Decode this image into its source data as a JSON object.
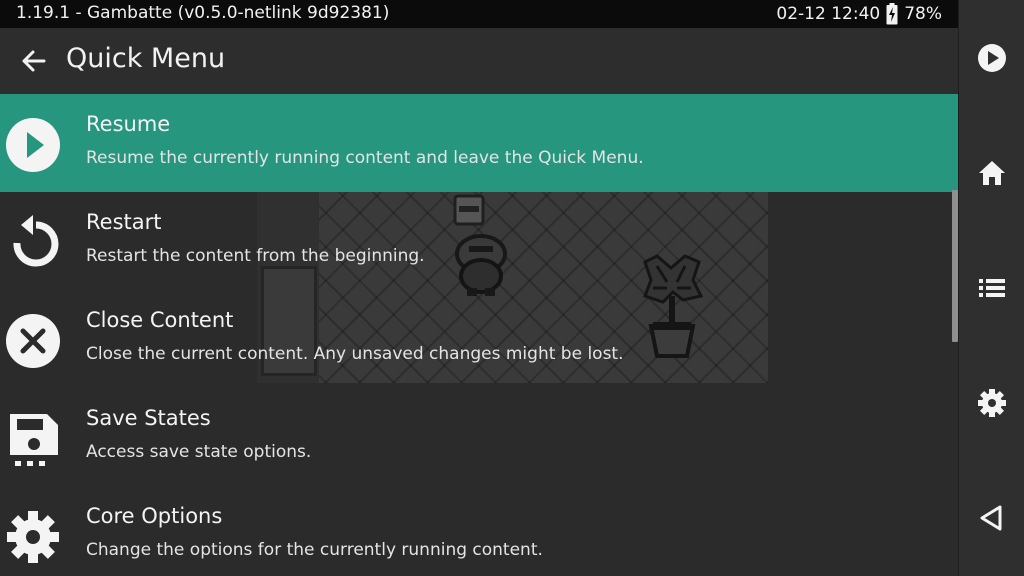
{
  "status_bar": {
    "title": "1.19.1 - Gambatte (v0.5.0-netlink 9d92381)",
    "datetime": "02-12 12:40",
    "battery_icon": "battery-charging-icon",
    "battery": "78%"
  },
  "header": {
    "back_icon": "arrow-left-icon",
    "title": "Quick Menu"
  },
  "menu": {
    "items": [
      {
        "icon": "play-circle-icon",
        "label": "Resume",
        "description": "Resume the currently running content and leave the Quick Menu.",
        "selected": true
      },
      {
        "icon": "restart-icon",
        "label": "Restart",
        "description": "Restart the content from the beginning.",
        "selected": false
      },
      {
        "icon": "close-circle-icon",
        "label": "Close Content",
        "description": "Close the current content. Any unsaved changes might be lost.",
        "selected": false
      },
      {
        "icon": "save-icon",
        "label": "Save States",
        "description": "Access save state options.",
        "selected": false
      },
      {
        "icon": "gear-icon",
        "label": "Core Options",
        "description": "Change the options for the currently running content.",
        "selected": false
      }
    ]
  },
  "sidebar": {
    "buttons": [
      "resume-icon",
      "home-icon",
      "list-icon",
      "settings-icon",
      "back-icon"
    ]
  },
  "colors": {
    "selection": "#26967f",
    "background": "#2b2b2b",
    "status_bar": "#0b0b0b",
    "sidebar": "#2f2f2f"
  }
}
